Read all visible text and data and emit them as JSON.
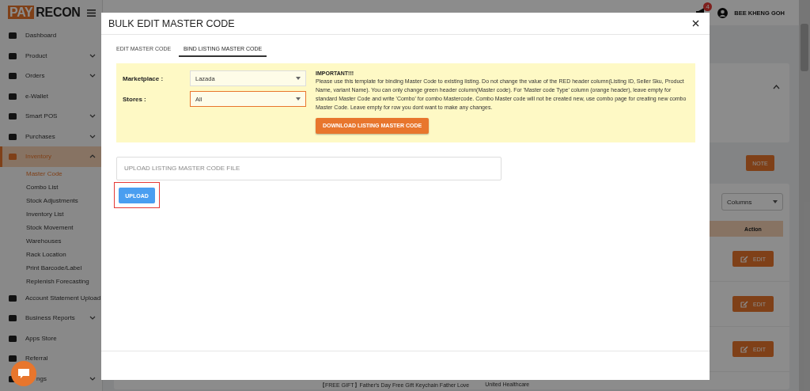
{
  "brand": {
    "logo_left": "PAY",
    "logo_right": "RECON"
  },
  "topbar": {
    "notification_count": "4",
    "user": "BEE KHENG GOH"
  },
  "sidebar": {
    "items": [
      {
        "label": "Dashboard",
        "kind": "link",
        "selected": false
      },
      {
        "label": "Product",
        "kind": "menu",
        "expanded": false,
        "selected": false
      },
      {
        "label": "Orders",
        "kind": "menu",
        "expanded": false,
        "selected": false
      },
      {
        "label": "e-Wallet",
        "kind": "link",
        "selected": false
      },
      {
        "label": "Smart POS",
        "kind": "menu",
        "expanded": false,
        "selected": false
      },
      {
        "label": "Purchases",
        "kind": "menu",
        "expanded": false,
        "selected": false
      },
      {
        "label": "Inventory",
        "kind": "menu",
        "expanded": true,
        "selected": true,
        "children": [
          {
            "label": "Master Code",
            "selected": true
          },
          {
            "label": "Combo List",
            "selected": false
          },
          {
            "label": "Stock Adjustments",
            "selected": false
          },
          {
            "label": "Inventory List",
            "selected": false
          },
          {
            "label": "Stock Movement",
            "selected": false
          },
          {
            "label": "Warehouses",
            "selected": false
          },
          {
            "label": "Rack Location",
            "selected": false
          },
          {
            "label": "Print Barcode/Label",
            "selected": false
          },
          {
            "label": "Replenish Forecasting",
            "selected": false
          }
        ]
      },
      {
        "label": "Account Statement Upload",
        "kind": "link",
        "selected": false
      },
      {
        "label": "Business Reports",
        "kind": "menu",
        "expanded": false,
        "selected": false
      },
      {
        "label": "Apps Store",
        "kind": "link",
        "selected": false
      },
      {
        "label": "Referral",
        "kind": "link",
        "selected": false
      },
      {
        "label": "ngs",
        "kind": "menu",
        "expanded": false,
        "selected": false
      }
    ]
  },
  "background": {
    "note_button": "NOTE",
    "columns_select": "Columns",
    "table": {
      "columns": [
        "Action"
      ],
      "rows": [
        {
          "action": "EDIT"
        },
        {
          "action": "EDIT"
        },
        {
          "action": "EDIT"
        }
      ],
      "partial_row": {
        "product": "【FREE GIFT】Father's Day Free Gift Keychain Father Love",
        "store": "United Healthcare"
      }
    }
  },
  "modal": {
    "title": "BULK EDIT MASTER CODE",
    "tabs": [
      {
        "label": "EDIT MASTER CODE",
        "selected": false
      },
      {
        "label": "BIND LISTING MASTER CODE",
        "selected": true
      }
    ],
    "fields": [
      {
        "label": "Marketplace :",
        "value": "Lazada",
        "focused": false
      },
      {
        "label": "Stores :",
        "value": "All",
        "focused": true
      }
    ],
    "notice": {
      "title": "IMPORTANT!!!",
      "text": "Please use this template for binding Master Code to existing listing. Do not change the value of the RED header column(Listing ID, Seller Sku, Product Name, variant Name). You can only change green header column(Master code). For 'Master code Type' column (orange header), leave empty for standard Master Code and write 'Combo' for combo Mastercode. Combo Master code will not be created new, use combo page for creating new combo Master Code. Leave empty for row you dont want to make any changes."
    },
    "download_button": "DOWNLOAD LISTING MASTER CODE",
    "upload_field": {
      "placeholder": "UPLOAD LISTING MASTER CODE FILE"
    },
    "upload_button": {
      "label": "UPLOAD",
      "highlighted": true
    }
  }
}
